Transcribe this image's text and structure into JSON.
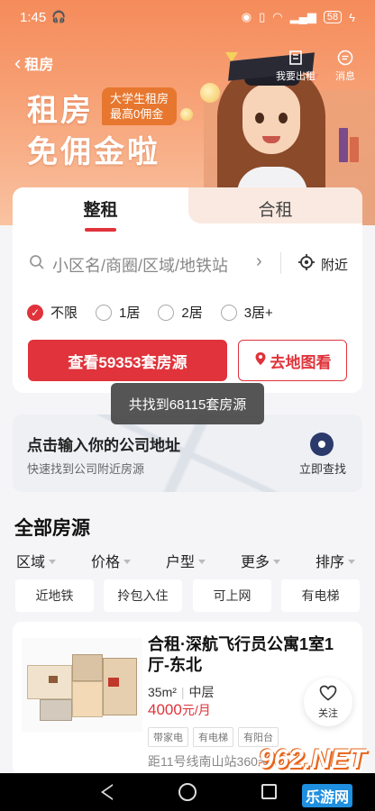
{
  "status_bar": {
    "time": "1:45",
    "battery": "58"
  },
  "nav": {
    "title": "租房",
    "publish_label": "我要出租",
    "messages_label": "消息"
  },
  "banner": {
    "slogan_line1": "租房",
    "slogan_line2": "免佣金啦",
    "badge_line1": "大学生租房",
    "badge_line2": "最高0佣金"
  },
  "tabs": [
    {
      "label": "整租",
      "active": true
    },
    {
      "label": "合租",
      "active": false
    }
  ],
  "search": {
    "placeholder": "小区名/商圈/区域/地铁站",
    "nearby_label": "附近"
  },
  "room_options": [
    {
      "label": "不限",
      "checked": true
    },
    {
      "label": "1居",
      "checked": false
    },
    {
      "label": "2居",
      "checked": false
    },
    {
      "label": "3居+",
      "checked": false
    }
  ],
  "actions": {
    "view_button": "查看59353套房源",
    "map_button": "去地图看"
  },
  "toast": "共找到68115套房源",
  "company": {
    "title": "点击输入你的公司地址",
    "subtitle": "快速找到公司附近房源",
    "action": "立即查找"
  },
  "section_title": "全部房源",
  "filters": [
    "区域",
    "价格",
    "户型",
    "更多",
    "排序"
  ],
  "quick_chips": [
    "近地铁",
    "拎包入住",
    "可上网",
    "有电梯"
  ],
  "listing": {
    "title": "合租·深航飞行员公寓1室1厅-东北",
    "area": "35m²",
    "floor": "中层",
    "price": "4000",
    "price_unit": "元/月",
    "tags": [
      "带家电",
      "有电梯",
      "有阳台"
    ],
    "distance": "距11号线南山站360米",
    "favorite_label": "关注"
  },
  "watermark": {
    "brand": "962.NET",
    "sub": "乐游网"
  },
  "colors": {
    "accent": "#e0333b",
    "hero_orange": "#f58b5a",
    "badge": "#e7772f"
  }
}
